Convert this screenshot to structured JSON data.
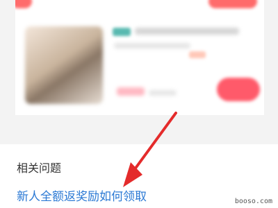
{
  "related": {
    "title": "相关问题",
    "link": "新人全额返奖励如何领取"
  },
  "watermark": "booso.com",
  "colors": {
    "accent_red": "#e42b2b",
    "link_blue": "#2b79d4",
    "product_button": "#ff5a6a"
  },
  "icons": [
    "red-arrow-icon"
  ]
}
